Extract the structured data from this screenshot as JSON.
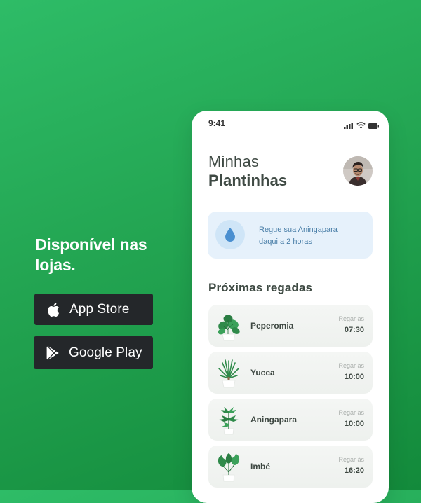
{
  "promo": {
    "title_line1": "Disponível nas",
    "title_line2": "lojas.",
    "buttons": [
      {
        "label": "App Store",
        "icon": "apple-icon"
      },
      {
        "label": "Google Play",
        "icon": "google-play-icon"
      }
    ]
  },
  "phone": {
    "status_time": "9:41",
    "header": {
      "line1": "Minhas",
      "line2": "Plantinhas"
    },
    "reminder": {
      "line1": "Regue sua Aningapara",
      "line2": "daqui a 2 horas",
      "icon": "water-drop-icon"
    },
    "section_title": "Próximas regadas",
    "plants": [
      {
        "name": "Peperomia",
        "label": "Regar às",
        "time": "07:30"
      },
      {
        "name": "Yucca",
        "label": "Regar às",
        "time": "10:00"
      },
      {
        "name": "Aningapara",
        "label": "Regar às",
        "time": "10:00"
      },
      {
        "name": "Imbé",
        "label": "Regar às",
        "time": "16:20"
      }
    ]
  },
  "colors": {
    "background_start": "#2ebc67",
    "background_end": "#138a3b",
    "button_bg": "#24272a",
    "reminder_bg": "#e6f1fb",
    "reminder_text": "#4a7fa8",
    "card_bg": "#f2f4f2"
  }
}
